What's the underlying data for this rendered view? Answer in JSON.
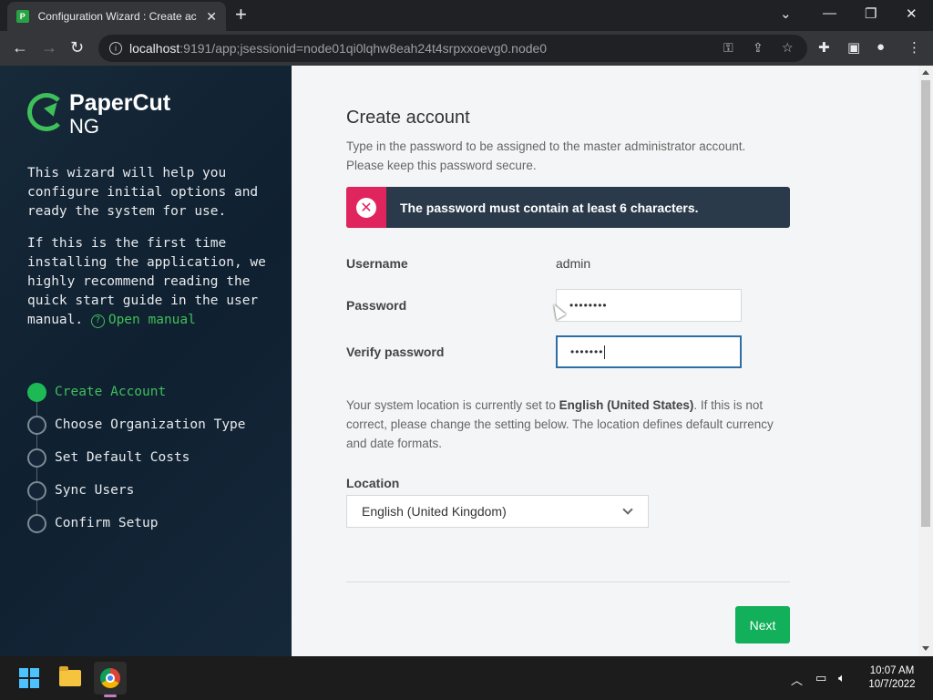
{
  "browser": {
    "tab_title": "Configuration Wizard : Create ac",
    "tab_favicon": "P",
    "url_host": "localhost",
    "url_rest": ":9191/app;jsessionid=node01qi0lqhw8eah24t4srpxxoevg0.node0"
  },
  "sidebar": {
    "logo_brand": "PaperCut",
    "logo_suffix": "NG",
    "intro_1": "This wizard will help you configure initial options and ready the system for use.",
    "intro_2": "If this is the first time installing the application, we highly recommend reading the quick start guide in the user manual.",
    "manual_link": "Open manual",
    "steps": [
      {
        "label": "Create Account",
        "active": true
      },
      {
        "label": "Choose Organization Type",
        "active": false
      },
      {
        "label": "Set Default Costs",
        "active": false
      },
      {
        "label": "Sync Users",
        "active": false
      },
      {
        "label": "Confirm Setup",
        "active": false
      }
    ]
  },
  "main": {
    "title": "Create account",
    "description": "Type in the password to be assigned to the master administrator account. Please keep this password secure.",
    "error": "The password must contain at least 6 characters.",
    "username_label": "Username",
    "username_value": "admin",
    "password_label": "Password",
    "password_value": "••••••••",
    "verify_label": "Verify password",
    "verify_value": "•••••••",
    "location_text_pre": "Your system location is currently set to ",
    "location_current": "English (United States)",
    "location_text_post": ". If this is not correct, please change the setting below. The location defines default currency and date formats.",
    "location_label": "Location",
    "location_selected": "English (United Kingdom)",
    "next_button": "Next"
  },
  "taskbar": {
    "time": "10:07 AM",
    "date": "10/7/2022"
  }
}
